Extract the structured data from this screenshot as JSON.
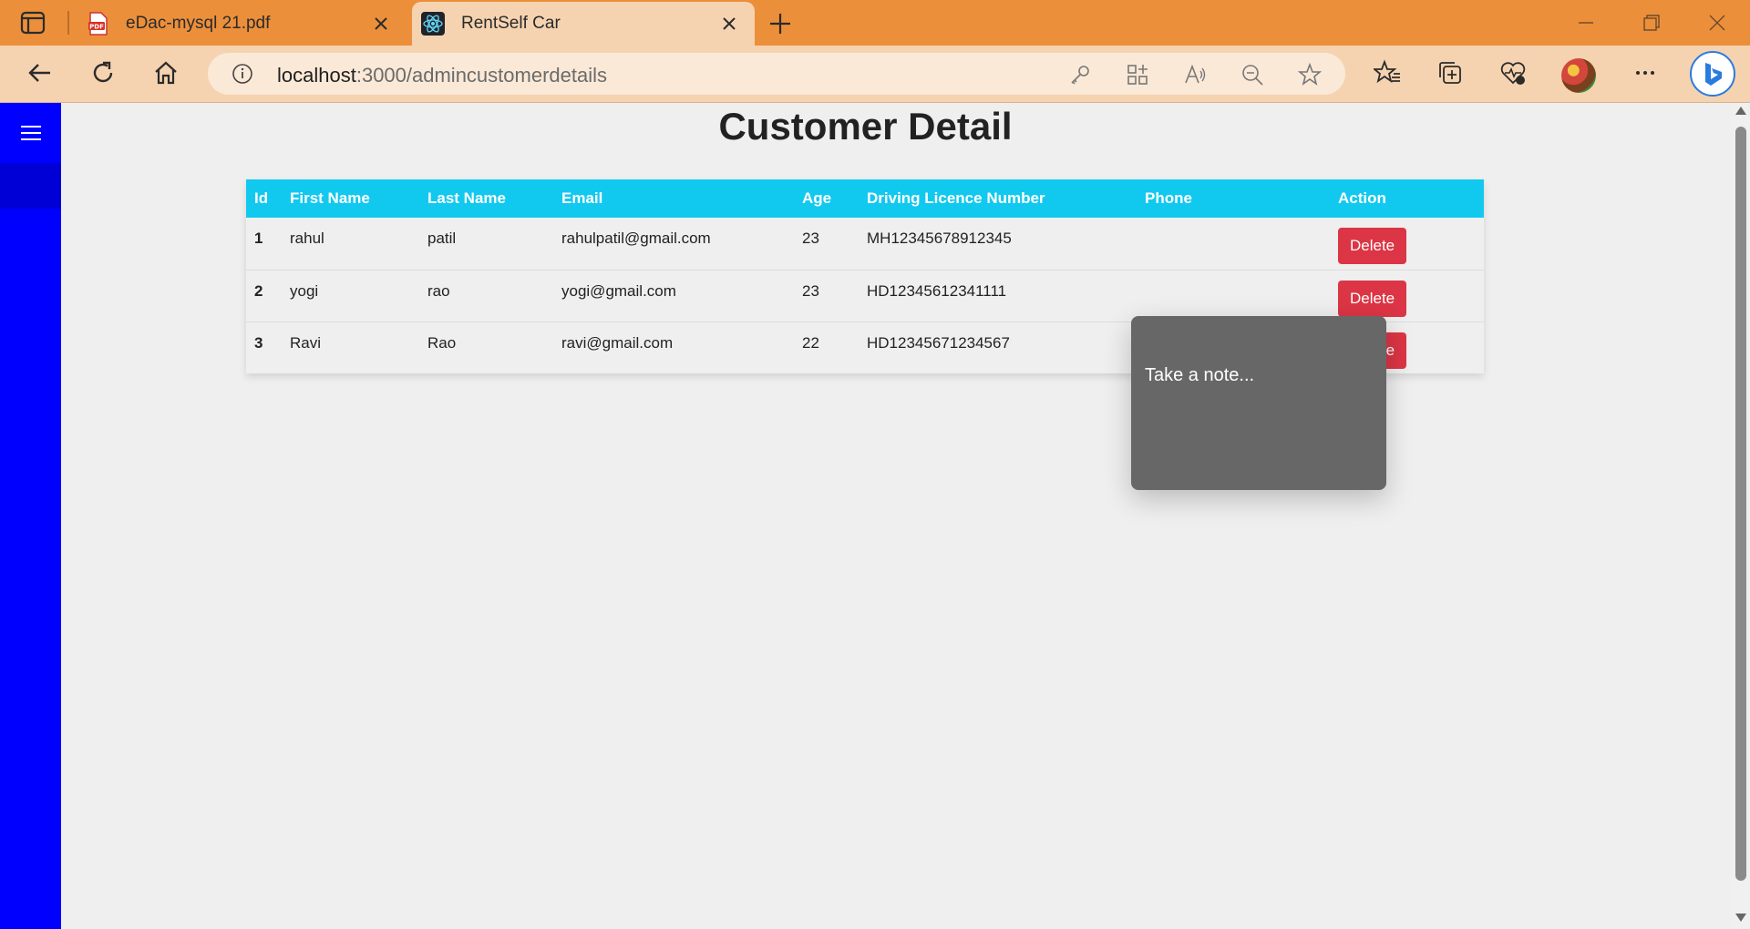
{
  "browser": {
    "tabs": [
      {
        "title": "eDac-mysql 21.pdf",
        "icon": "pdf-icon",
        "active": false
      },
      {
        "title": "RentSelf Car",
        "icon": "react-icon",
        "active": true
      }
    ],
    "url_host": "localhost",
    "url_path": ":3000/admincustomerdetails"
  },
  "page": {
    "title": "Customer Detail"
  },
  "table": {
    "columns": [
      "Id",
      "First Name",
      "Last Name",
      "Email",
      "Age",
      "Driving Licence Number",
      "Phone",
      "Action"
    ],
    "rows": [
      {
        "id": "1",
        "first_name": "rahul",
        "last_name": "patil",
        "email": "rahulpatil@gmail.com",
        "age": "23",
        "licence": "MH12345678912345",
        "phone": "",
        "action": "Delete"
      },
      {
        "id": "2",
        "first_name": "yogi",
        "last_name": "rao",
        "email": "yogi@gmail.com",
        "age": "23",
        "licence": "HD12345612341111",
        "phone": "",
        "action": "Delete"
      },
      {
        "id": "3",
        "first_name": "Ravi",
        "last_name": "Rao",
        "email": "ravi@gmail.com",
        "age": "22",
        "licence": "HD12345671234567",
        "phone": "",
        "action": "Delete"
      }
    ]
  },
  "note_popup": {
    "placeholder": "Take a note..."
  },
  "colors": {
    "tabbar": "#ec8f3a",
    "toolbar": "#f6d3b0",
    "sidebar": "#0000ff",
    "table_header": "#11c9ef",
    "delete_button": "#dc3545",
    "note_popup": "#676767"
  }
}
